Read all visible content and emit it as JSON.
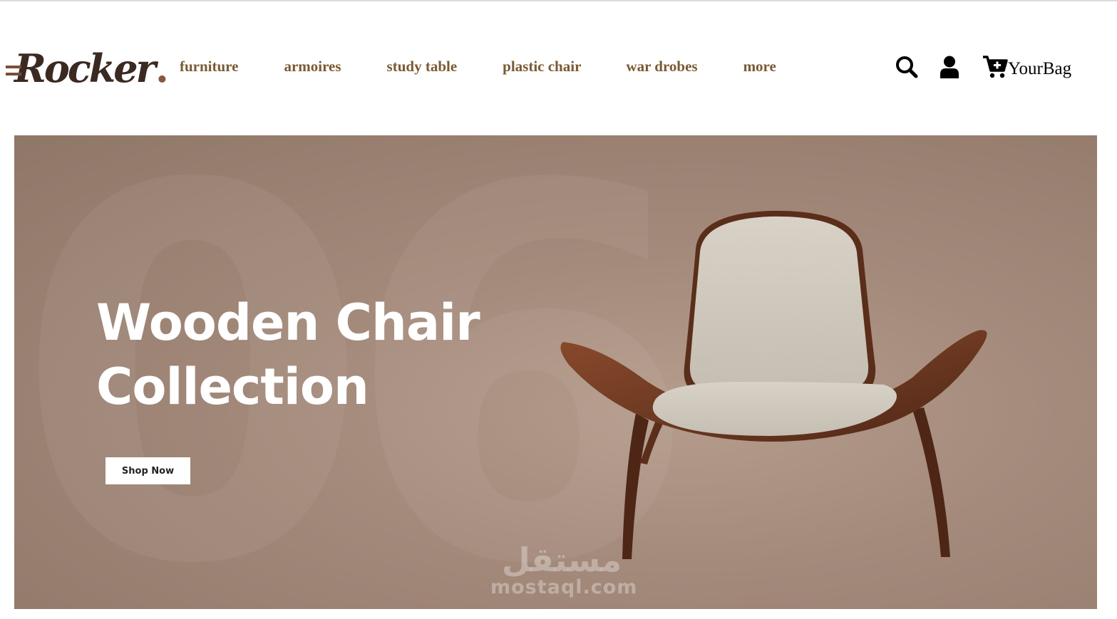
{
  "brand": {
    "logo_text": "Rocker",
    "logo_dot": "."
  },
  "nav": {
    "items": [
      {
        "label": "furniture"
      },
      {
        "label": "armoires"
      },
      {
        "label": "study table"
      },
      {
        "label": "plastic chair"
      },
      {
        "label": "war drobes"
      },
      {
        "label": "more"
      }
    ]
  },
  "header_actions": {
    "search_icon": "search-icon",
    "user_icon": "user-icon",
    "cart_icon": "cart-plus-icon",
    "bag_label": "YourBag"
  },
  "hero": {
    "title_line1": "Wooden Chair",
    "title_line2": "Collection",
    "cta_label": "Shop Now",
    "background_numeral": "06"
  },
  "watermark": {
    "arabic": "مستقل",
    "latin": "mostaql.com"
  },
  "colors": {
    "nav_text": "#7a5a33",
    "logo_dark": "#3b2a22",
    "logo_accent": "#8a5542",
    "hero_bg": "#a48a7b"
  }
}
